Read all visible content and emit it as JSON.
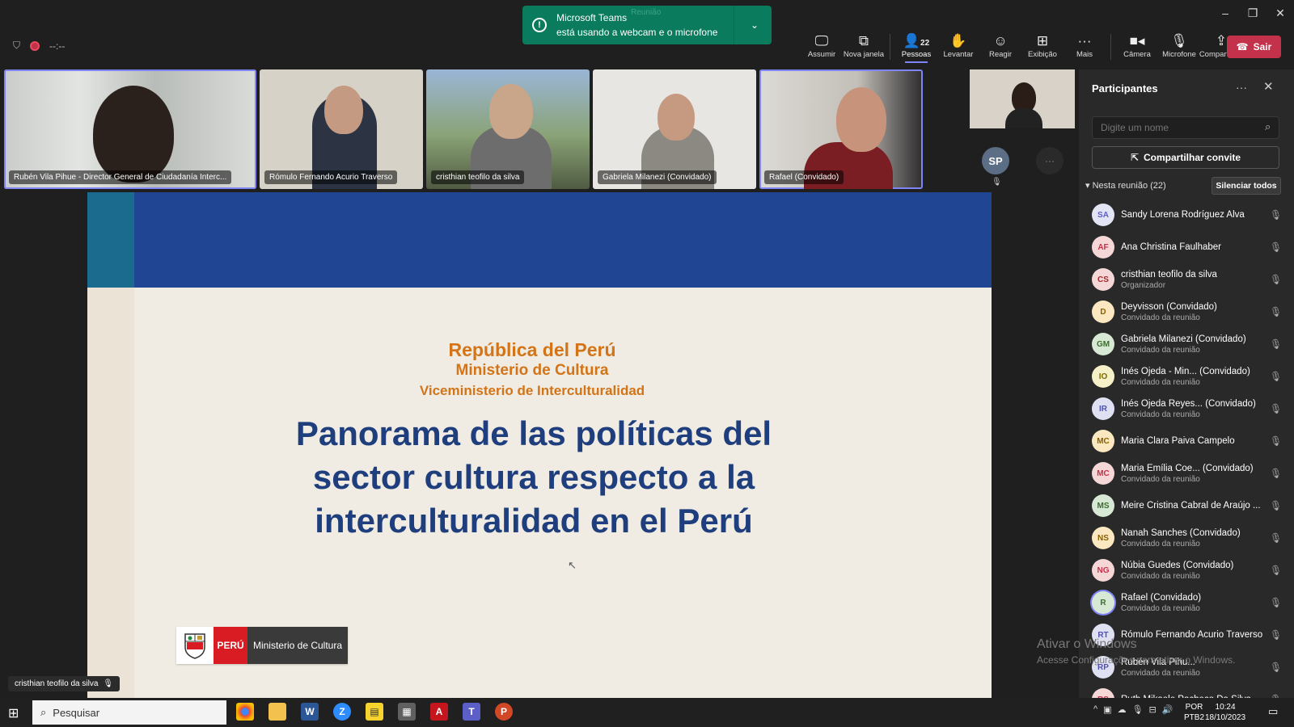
{
  "toast": {
    "title": "Microsoft Teams",
    "message": "está usando a webcam e o microfone",
    "faint": "Reunião"
  },
  "header": {
    "timer": "--:--"
  },
  "toolbar": {
    "items": [
      {
        "label": "Assumir",
        "icon": "take-control-icon"
      },
      {
        "label": "Nova janela",
        "icon": "pop-out-icon"
      },
      {
        "label": "Pessoas",
        "icon": "people-icon",
        "count": "22"
      },
      {
        "label": "Levantar",
        "icon": "raise-hand-icon"
      },
      {
        "label": "Reagir",
        "icon": "react-icon"
      },
      {
        "label": "Exibição",
        "icon": "view-icon"
      },
      {
        "label": "Mais",
        "icon": "more-icon"
      },
      {
        "label": "Câmera",
        "icon": "camera-icon"
      },
      {
        "label": "Microfone",
        "icon": "mic-off-icon"
      },
      {
        "label": "Compartilhar",
        "icon": "share-icon"
      }
    ],
    "leave": "Sair"
  },
  "videos": [
    {
      "name": "Rubén Vila Pihue - Director General de Ciudadanía Interc..."
    },
    {
      "name": "Rómulo Fernando Acurio Traverso"
    },
    {
      "name": "cristhian teofilo da silva"
    },
    {
      "name": "Gabriela Milanezi (Convidado)"
    },
    {
      "name": "Rafael (Convidado)"
    }
  ],
  "side_avatar": {
    "initials": "SP",
    "more": "···"
  },
  "slide": {
    "line1": "República del Perú",
    "line2": "Ministerio de Cultura",
    "line3": "Viceministerio de Interculturalidad",
    "title1": "Panorama de las políticas del",
    "title2": "sector cultura respecto a la",
    "title3": "interculturalidad en el Perú",
    "logo_peru": "PERÚ",
    "logo_min": "Ministerio de Cultura"
  },
  "speaker_label": "cristhian teofilo da silva",
  "watermark": {
    "title": "Ativar o Windows",
    "sub": "Acesse Configurações para ativar o Windows."
  },
  "panel": {
    "title": "Participantes",
    "search_placeholder": "Digite um nome",
    "share": "Compartilhar convite",
    "section": "Nesta reunião (22)",
    "mute_all": "Silenciar todos",
    "participants": [
      {
        "initials": "SA",
        "name": "Sandy Lorena Rodríguez Alva",
        "sub": "",
        "color": "#e4e4f7",
        "fg": "#5b5fc7"
      },
      {
        "initials": "AF",
        "name": "Ana Christina Faulhaber",
        "sub": "",
        "color": "#f6d7d7",
        "fg": "#c4314b"
      },
      {
        "initials": "CS",
        "name": "cristhian teofilo da silva",
        "sub": "Organizador",
        "color": "#f6d7d7",
        "fg": "#a4262c"
      },
      {
        "initials": "D",
        "name": "Deyvisson (Convidado)",
        "sub": "Convidado da reunião",
        "color": "#fbe8c0",
        "fg": "#8a6100"
      },
      {
        "initials": "GM",
        "name": "Gabriela Milanezi (Convidado)",
        "sub": "Convidado da reunião",
        "color": "#d7e8d4",
        "fg": "#3c6e2f"
      },
      {
        "initials": "IO",
        "name": "Inés Ojeda - Min... (Convidado)",
        "sub": "Convidado da reunião",
        "color": "#f5f0c7",
        "fg": "#7a6a00"
      },
      {
        "initials": "IR",
        "name": "Inés Ojeda Reyes... (Convidado)",
        "sub": "Convidado da reunião",
        "color": "#dfe1f3",
        "fg": "#4f52b2"
      },
      {
        "initials": "MC",
        "name": "Maria Clara Paiva Campelo",
        "sub": "",
        "color": "#fbe8c0",
        "fg": "#8a6100"
      },
      {
        "initials": "MC",
        "name": "Maria Emília Coe... (Convidado)",
        "sub": "Convidado da reunião",
        "color": "#f6d7d7",
        "fg": "#c4314b"
      },
      {
        "initials": "MS",
        "name": "Meire Cristina Cabral de Araújo ...",
        "sub": "",
        "color": "#d7e8d4",
        "fg": "#3c6e2f"
      },
      {
        "initials": "NS",
        "name": "Nanah Sanches (Convidado)",
        "sub": "Convidado da reunião",
        "color": "#fbe8c0",
        "fg": "#8a6100"
      },
      {
        "initials": "NG",
        "name": "Núbia Guedes (Convidado)",
        "sub": "Convidado da reunião",
        "color": "#f6d7d7",
        "fg": "#c4314b"
      },
      {
        "initials": "R",
        "name": "Rafael (Convidado)",
        "sub": "Convidado da reunião",
        "color": "#d7e8d4",
        "fg": "#3c6e2f"
      },
      {
        "initials": "RT",
        "name": "Rómulo Fernando Acurio Traverso",
        "sub": "",
        "color": "#dfe1f3",
        "fg": "#4f52b2"
      },
      {
        "initials": "RP",
        "name": "Rubén Vila Pihu...",
        "sub": "Convidado da reunião",
        "color": "#dfe1f3",
        "fg": "#4f52b2"
      },
      {
        "initials": "RS",
        "name": "Ruth Mikaele Pacheco Da Silva",
        "sub": "",
        "color": "#f6d7d7",
        "fg": "#c4314b"
      }
    ]
  },
  "taskbar": {
    "search": "Pesquisar",
    "lang1": "POR",
    "lang2": "PTB2",
    "time": "10:24",
    "date": "18/10/2023"
  }
}
